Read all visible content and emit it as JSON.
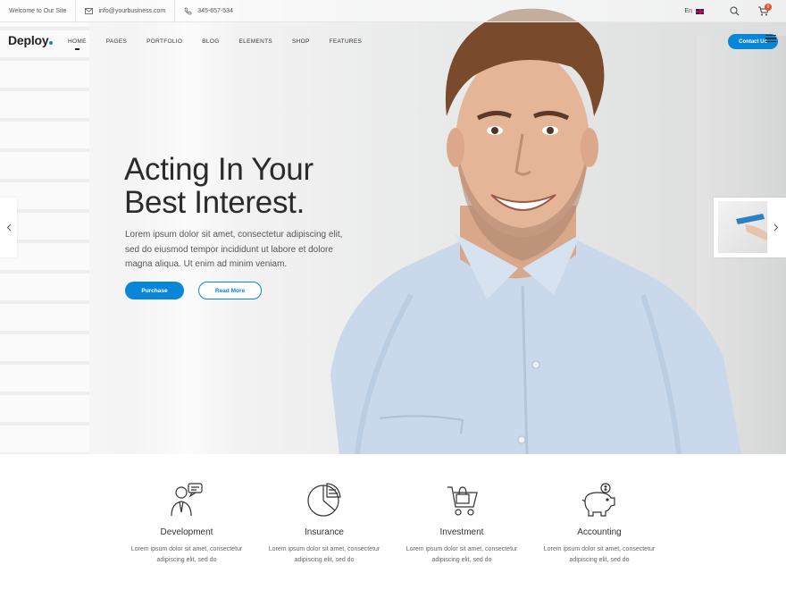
{
  "topbar": {
    "welcome": "Welcome to Our Site",
    "email": "info@yourbusiness.com",
    "phone": "345-657-534",
    "language": "En",
    "cart_count": "0"
  },
  "brand": {
    "logo": "Deploy"
  },
  "nav": {
    "items": [
      "HOME",
      "PAGES",
      "PORTFOLIO",
      "BLOG",
      "ELEMENTS",
      "SHOP",
      "FEATURES"
    ],
    "contact_label": "Contact Us"
  },
  "hero": {
    "headline_line1": "Acting In Your",
    "headline_line2": "Best Interest.",
    "description": "Lorem ipsum dolor sit amet, consectetur adipiscing elit, sed do eiusmod tempor incididunt ut labore et dolore magna aliqua. Ut enim ad minim veniam.",
    "purchase_label": "Purchase",
    "read_more_label": "Read More"
  },
  "features": [
    {
      "title": "Development",
      "icon": "person-chat-icon",
      "desc_line1": "Lorem ipsum dolor sit amet, consectetur",
      "desc_line2": "adipiscing elit, sed do"
    },
    {
      "title": "Insurance",
      "icon": "pie-chart-icon",
      "desc_line1": "Lorem ipsum dolor sit amet, consectetur",
      "desc_line2": "adipiscing elit, sed do"
    },
    {
      "title": "Investment",
      "icon": "shopping-cart-icon",
      "desc_line1": "Lorem ipsum dolor sit amet, consectetur",
      "desc_line2": "adipiscing elit, sed do"
    },
    {
      "title": "Accounting",
      "icon": "piggy-bank-icon",
      "desc_line1": "Lorem ipsum dolor sit amet, consectetur",
      "desc_line2": "adipiscing elit, sed do"
    }
  ],
  "colors": {
    "accent": "#0a86d8",
    "badge": "#e4502b",
    "heading": "#2b2b2b"
  }
}
